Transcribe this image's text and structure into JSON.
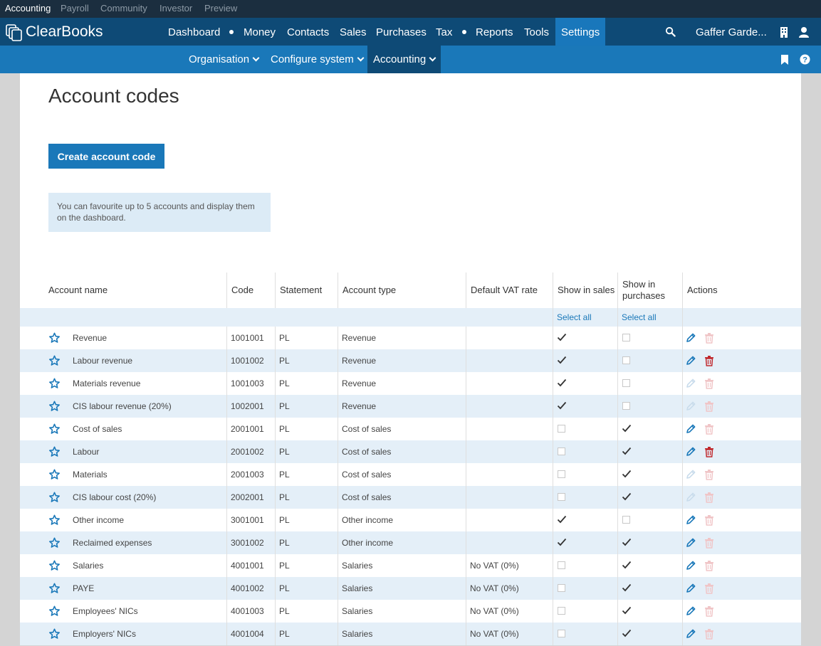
{
  "topbar": {
    "items": [
      "Accounting",
      "Payroll",
      "Community",
      "Investor",
      "Preview"
    ],
    "active_index": 0
  },
  "brand": {
    "name": "ClearBooks"
  },
  "mainnav": {
    "items": [
      "Dashboard",
      "Money",
      "Contacts",
      "Sales",
      "Purchases",
      "Tax",
      "Reports",
      "Tools",
      "Settings"
    ],
    "active": "Settings",
    "company": "Gaffer Garde..."
  },
  "subnav": {
    "items": [
      "Organisation",
      "Configure system",
      "Accounting"
    ],
    "active": "Accounting"
  },
  "page": {
    "title": "Account codes",
    "create_button": "Create account code",
    "info_text": "You can favourite up to 5 accounts and display them on the dashboard."
  },
  "table": {
    "headers": [
      "Account name",
      "Code",
      "Statement",
      "Account type",
      "Default VAT rate",
      "Show in sales",
      "Show in purchases",
      "Actions"
    ],
    "select_all_sales": "Select all",
    "select_all_purchases": "Select all",
    "rows": [
      {
        "name": "Revenue",
        "code": "1001001",
        "statement": "PL",
        "type": "Revenue",
        "vat": "",
        "sales": true,
        "purchases": false,
        "edit": "enabled",
        "delete": "disabled"
      },
      {
        "name": "Labour revenue",
        "code": "1001002",
        "statement": "PL",
        "type": "Revenue",
        "vat": "",
        "sales": true,
        "purchases": false,
        "edit": "enabled",
        "delete": "enabled"
      },
      {
        "name": "Materials revenue",
        "code": "1001003",
        "statement": "PL",
        "type": "Revenue",
        "vat": "",
        "sales": true,
        "purchases": false,
        "edit": "disabled",
        "delete": "disabled"
      },
      {
        "name": "CIS labour revenue (20%)",
        "code": "1002001",
        "statement": "PL",
        "type": "Revenue",
        "vat": "",
        "sales": true,
        "purchases": false,
        "edit": "disabled",
        "delete": "disabled"
      },
      {
        "name": "Cost of sales",
        "code": "2001001",
        "statement": "PL",
        "type": "Cost of sales",
        "vat": "",
        "sales": false,
        "purchases": true,
        "edit": "enabled",
        "delete": "disabled"
      },
      {
        "name": "Labour",
        "code": "2001002",
        "statement": "PL",
        "type": "Cost of sales",
        "vat": "",
        "sales": false,
        "purchases": true,
        "edit": "enabled",
        "delete": "enabled"
      },
      {
        "name": "Materials",
        "code": "2001003",
        "statement": "PL",
        "type": "Cost of sales",
        "vat": "",
        "sales": false,
        "purchases": true,
        "edit": "disabled",
        "delete": "disabled"
      },
      {
        "name": "CIS labour cost (20%)",
        "code": "2002001",
        "statement": "PL",
        "type": "Cost of sales",
        "vat": "",
        "sales": false,
        "purchases": true,
        "edit": "disabled",
        "delete": "disabled"
      },
      {
        "name": "Other income",
        "code": "3001001",
        "statement": "PL",
        "type": "Other income",
        "vat": "",
        "sales": true,
        "purchases": false,
        "edit": "enabled",
        "delete": "disabled"
      },
      {
        "name": "Reclaimed expenses",
        "code": "3001002",
        "statement": "PL",
        "type": "Other income",
        "vat": "",
        "sales": true,
        "purchases": true,
        "edit": "enabled",
        "delete": "disabled"
      },
      {
        "name": "Salaries",
        "code": "4001001",
        "statement": "PL",
        "type": "Salaries",
        "vat": "No VAT (0%)",
        "sales": false,
        "purchases": true,
        "edit": "enabled",
        "delete": "disabled"
      },
      {
        "name": "PAYE",
        "code": "4001002",
        "statement": "PL",
        "type": "Salaries",
        "vat": "No VAT (0%)",
        "sales": false,
        "purchases": true,
        "edit": "enabled",
        "delete": "disabled"
      },
      {
        "name": "Employees' NICs",
        "code": "4001003",
        "statement": "PL",
        "type": "Salaries",
        "vat": "No VAT (0%)",
        "sales": false,
        "purchases": true,
        "edit": "enabled",
        "delete": "disabled"
      },
      {
        "name": "Employers' NICs",
        "code": "4001004",
        "statement": "PL",
        "type": "Salaries",
        "vat": "No VAT (0%)",
        "sales": false,
        "purchases": true,
        "edit": "enabled",
        "delete": "disabled"
      }
    ]
  },
  "colors": {
    "topbar": "#1b2e3f",
    "nav": "#0e4a76",
    "accent": "#1a78b9",
    "row_alt": "#e4eff8",
    "delete_red": "#c0282d"
  }
}
